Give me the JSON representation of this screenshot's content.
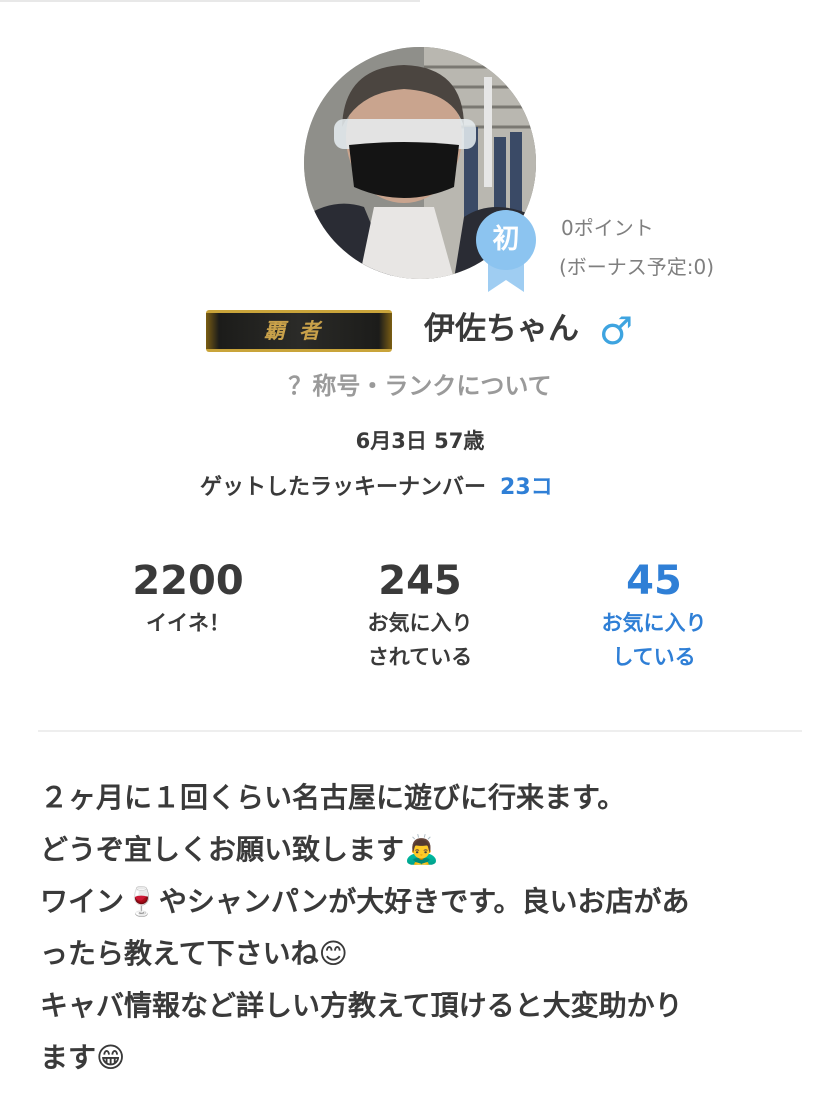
{
  "profile": {
    "rank_badge": "初",
    "points": "0ポイント",
    "bonus": "(ボーナス予定:0)",
    "title_plate": "覇者",
    "username": "伊佐ちゃん",
    "gender_symbol": "♂",
    "rank_info_link": "？称号・ランクについて",
    "birthday_age": "6月3日 57歳",
    "lucky_label": "ゲットしたラッキーナンバー",
    "lucky_count": "23コ"
  },
  "stats": [
    {
      "value": "2200",
      "label_line1": "イイネ！",
      "label_line2": ""
    },
    {
      "value": "245",
      "label_line1": "お気に入り",
      "label_line2": "されている"
    },
    {
      "value": "45",
      "label_line1": "お気に入り",
      "label_line2": "している"
    }
  ],
  "bio": [
    "２ヶ月に１回くらい名古屋に遊びに行来ます。",
    "どうぞ宜しくお願い致します🙇‍♂️",
    "ワイン🍷やシャンパンが大好きです。良いお店があ",
    "ったら教えて下さいね😊",
    "キャバ情報など詳しい方教えて頂けると大変助かり",
    "ます😁"
  ],
  "colors": {
    "accent_blue": "#2f7fd6",
    "badge_blue": "#8cc4f0",
    "gender_blue": "#3ea4e0",
    "text": "#3a3a3a",
    "muted": "#9a9a9a"
  }
}
